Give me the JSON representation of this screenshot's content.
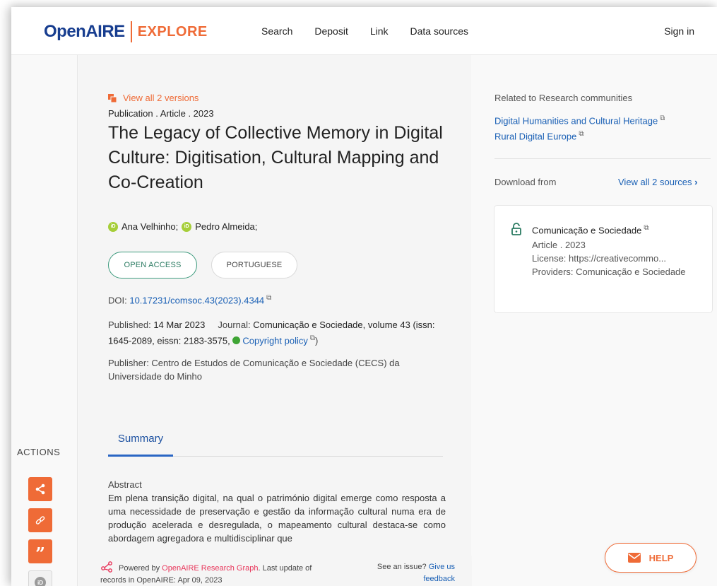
{
  "header": {
    "logo_open": "Open",
    "logo_aire": "AIRE",
    "logo_explore": "EXPLORE",
    "nav": [
      "Search",
      "Deposit",
      "Link",
      "Data sources"
    ],
    "signin": "Sign in"
  },
  "rail": {
    "actions_label": "ACTIONS",
    "buttons": [
      "share-icon",
      "link-icon",
      "quote-icon",
      "orcid-icon"
    ]
  },
  "main": {
    "versions": "View all 2 versions",
    "type": "Publication . Article . 2023",
    "title": "The Legacy of Collective Memory in Digital Culture: Digitisation, Cultural Mapping and Co-Creation",
    "authors": [
      "Ana Velhinho;",
      "Pedro Almeida;"
    ],
    "badge_access": "OPEN ACCESS",
    "badge_language": "PORTUGUESE",
    "doi_label": "DOI: ",
    "doi_value": "10.17231/comsoc.43(2023).4344",
    "published_label": "Published: ",
    "published_value": "14 Mar 2023",
    "journal_label": "Journal: ",
    "journal_value": "Comunicação e Sociedade, volume 43 (issn: 1645-2089, eissn: 2183-3575,",
    "copyright_link": "Copyright policy",
    "publisher_label": "Publisher: ",
    "publisher_value": "Centro de Estudos de Comunicação e Sociedade (CECS) da Universidade do Minho",
    "tab_summary": "Summary",
    "abstract_label": "Abstract",
    "abstract_text": "Em plena transição digital, na qual o património digital emerge como resposta a uma necessidade de preservação e gestão da informação cultural numa era de produção acelerada e desregulada, o mapeamento cultural destaca-se como abordagem agregadora e multidisciplinar que"
  },
  "footer": {
    "powered_prefix": "Powered by ",
    "powered_link": "OpenAIRE Research Graph",
    "powered_suffix": ". Last update of records in OpenAIRE: Apr 09, 2023",
    "issue_prefix": "See an issue? ",
    "issue_link": "Give us feedback"
  },
  "side": {
    "related_label": "Related to Research communities",
    "communities": [
      "Digital Humanities and Cultural Heritage",
      "Rural Digital Europe"
    ],
    "download_label": "Download from",
    "view_all_sources": "View all 2 sources",
    "source": {
      "title": "Comunicação e Sociedade",
      "type": "Article . 2023",
      "license": "License: https://creativecommo...",
      "providers": "Providers: Comunicação e Sociedade"
    }
  },
  "help": {
    "label": "HELP"
  },
  "colors": {
    "brand_blue": "#173d8f",
    "accent_orange": "#ef6b37",
    "link_blue": "#1a60b5",
    "open_access_green": "#3e9b7e"
  }
}
